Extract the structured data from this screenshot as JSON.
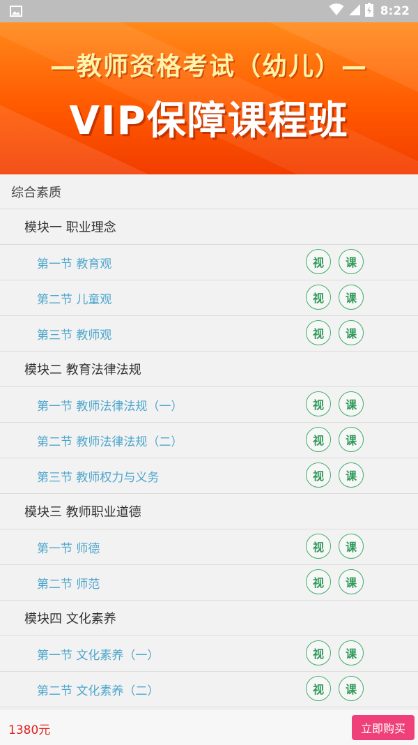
{
  "status_bar": {
    "time": "8:22",
    "icons": [
      "image-icon",
      "wifi-icon",
      "signal-icon",
      "battery-icon"
    ]
  },
  "banner": {
    "line1": "—教师资格考试（幼儿）—",
    "line2": "VIP保障课程班"
  },
  "category": {
    "label": "综合素质"
  },
  "modules": [
    {
      "title": "模块一 职业理念",
      "sections": [
        "第一节 教育观",
        "第二节 儿童观",
        "第三节 教师观"
      ]
    },
    {
      "title": "模块二 教育法律法规",
      "sections": [
        "第一节 教师法律法规（一）",
        "第二节 教师法律法规（二）",
        "第三节 教师权力与义务"
      ]
    },
    {
      "title": "模块三 教师职业道德",
      "sections": [
        "第一节 师德",
        "第二节 师范"
      ]
    },
    {
      "title": "模块四 文化素养",
      "sections": [
        "第一节 文化素养（一）",
        "第二节 文化素养（二）"
      ]
    }
  ],
  "section_buttons": {
    "video": "视",
    "lesson": "课"
  },
  "bottom_bar": {
    "price": "1380元",
    "buy_label": "立即购买"
  },
  "colors": {
    "accent_green": "#3fae6a",
    "section_text": "#4ea6cc",
    "price_red": "#e02020",
    "buy_pink": "#f0407a",
    "banner_orange": "#ff5a00"
  }
}
